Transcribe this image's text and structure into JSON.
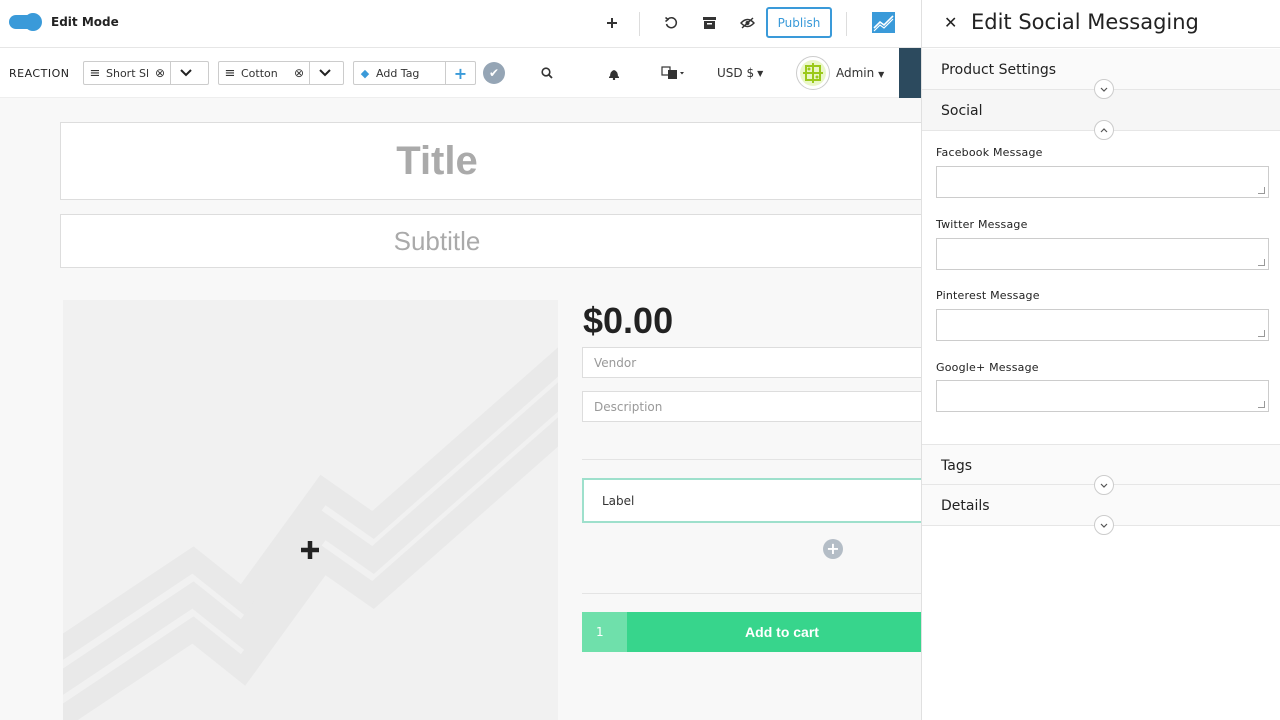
{
  "topbar": {
    "edit_mode_label": "Edit Mode",
    "publish_label": "Publish",
    "icons": [
      "plus-icon",
      "undo-icon",
      "archive-icon",
      "visibility-icon"
    ]
  },
  "navbar": {
    "brand": "REACTION",
    "tag_selects": [
      {
        "label": "Short Sl"
      },
      {
        "label": "Cotton"
      }
    ],
    "add_tag_placeholder": "Add Tag",
    "currency": "USD $",
    "user": "Admin"
  },
  "product": {
    "title_placeholder": "Title",
    "subtitle_placeholder": "Subtitle",
    "price": "$0.00",
    "vendor_placeholder": "Vendor",
    "description_placeholder": "Description",
    "label_value": "Label",
    "cart_qty": "1",
    "cart_label": "Add to cart"
  },
  "panel": {
    "title": "Edit Social Messaging",
    "sections": {
      "product_settings": "Product Settings",
      "social": "Social",
      "tags": "Tags",
      "details": "Details"
    },
    "fields": [
      {
        "label": "Facebook Message",
        "value": ""
      },
      {
        "label": "Twitter Message",
        "value": ""
      },
      {
        "label": "Pinterest Message",
        "value": ""
      },
      {
        "label": "Google+ Message",
        "value": ""
      }
    ]
  },
  "colors": {
    "accent": "#3a9ad9",
    "cart_green": "#37d58c",
    "label_border": "#9ee0cc"
  }
}
